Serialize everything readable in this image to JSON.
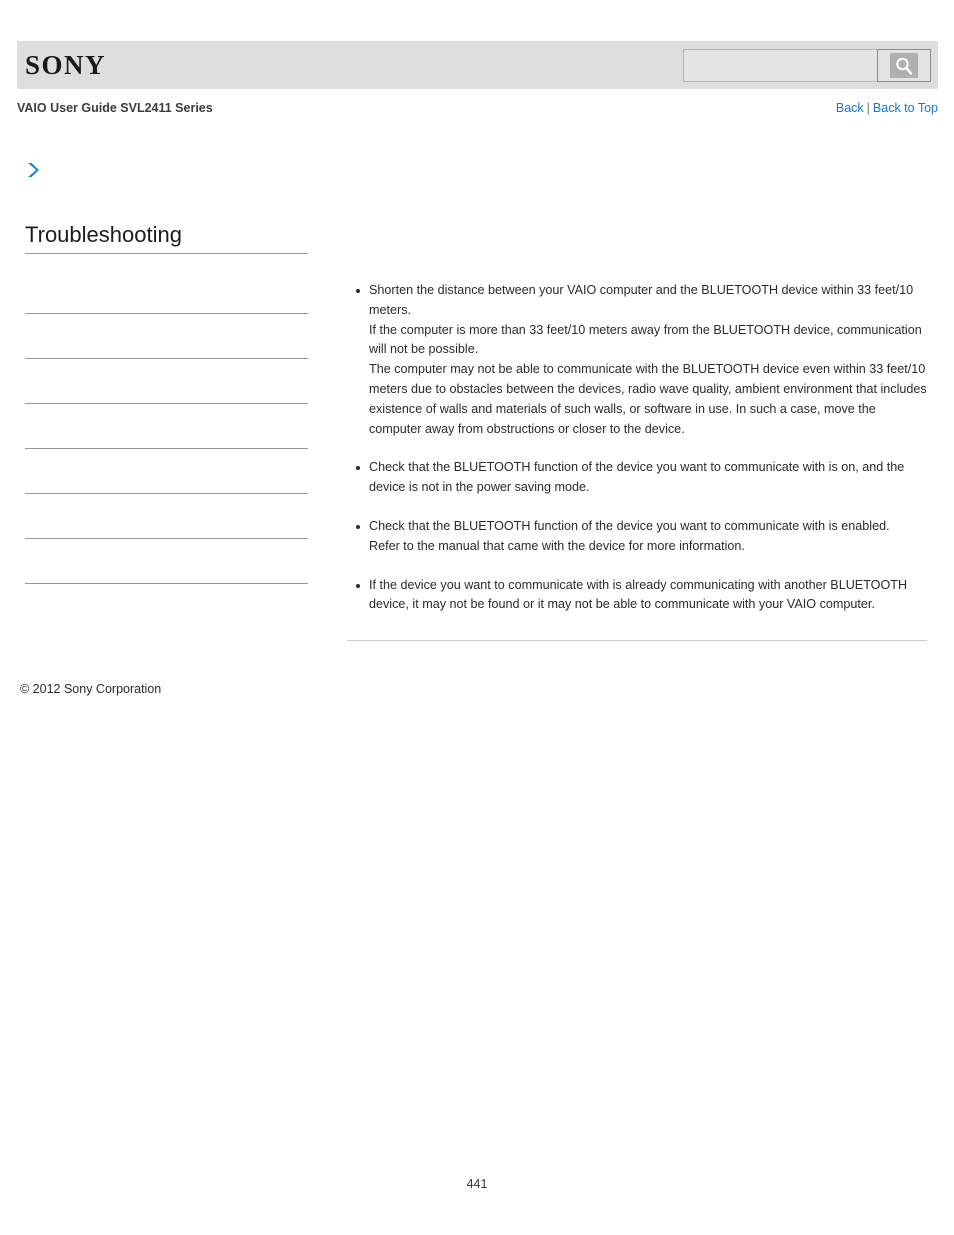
{
  "header": {
    "logo_text": "SONY",
    "search": {
      "value": "",
      "placeholder": "",
      "button_icon": "search-icon",
      "button_label": "Search"
    }
  },
  "subheader": {
    "guide_title": "VAIO User Guide SVL2411 Series",
    "links": {
      "back": "Back",
      "separator": "|",
      "back_to_top": "Back to Top"
    }
  },
  "sidebar": {
    "breadcrumb_icon": "chevron-right-icon",
    "title": "Troubleshooting",
    "items": [
      {
        "label": ""
      },
      {
        "label": ""
      },
      {
        "label": ""
      },
      {
        "label": ""
      },
      {
        "label": ""
      },
      {
        "label": ""
      },
      {
        "label": ""
      }
    ]
  },
  "content": {
    "tips": [
      {
        "lines": [
          "Shorten the distance between your VAIO computer and the BLUETOOTH device within 33 feet/10 meters.",
          "If the computer is more than 33 feet/10 meters away from the BLUETOOTH device, communication will not be possible.",
          "The computer may not be able to communicate with the BLUETOOTH device even within 33 feet/10 meters due to obstacles between the devices, radio wave quality, ambient environment that includes existence of walls and materials of such walls, or software in use. In such a case, move the computer away from obstructions or closer to the device."
        ]
      },
      {
        "lines": [
          "Check that the BLUETOOTH function of the device you want to communicate with is on, and the device is not in the power saving mode."
        ]
      },
      {
        "lines": [
          "Check that the BLUETOOTH function of the device you want to communicate with is enabled.",
          "Refer to the manual that came with the device for more information."
        ]
      },
      {
        "lines": [
          "If the device you want to communicate with is already communicating with another BLUETOOTH device, it may not be found or it may not be able to communicate with your VAIO computer."
        ]
      }
    ]
  },
  "footer": {
    "copyright": "© 2012 Sony Corporation",
    "page_number": "441"
  },
  "colors": {
    "header_bar": "#dedede",
    "link_blue": "#1878c8",
    "chevron_blue": "#2086c8",
    "rule_gray": "#979797"
  }
}
